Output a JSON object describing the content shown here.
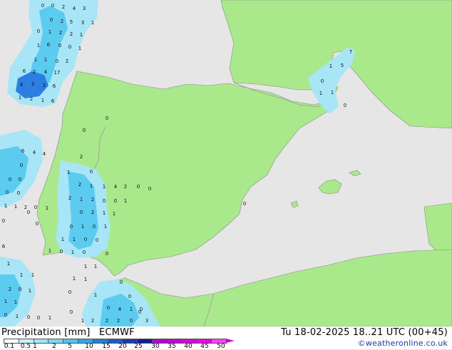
{
  "colors": {
    "sea": "#e6e6e6",
    "land": "#aae88c",
    "border": "#999999",
    "rain_light": "#a8e6f7",
    "rain_mid": "#5ccbf0",
    "rain_heavy": "#2c7fe0",
    "legend": [
      "#ffffff",
      "#c8f0fa",
      "#a0e4f7",
      "#7cd6f2",
      "#50c4ec",
      "#2ca8e4",
      "#1f7ed8",
      "#1e5bc8",
      "#1e38b0",
      "#191c8c",
      "#b400d0",
      "#c800d8",
      "#dc00e4",
      "#f000f0",
      "#ff40ff"
    ]
  },
  "footer": {
    "legend_title": "Precipitation [mm]",
    "model": "ECMWF",
    "valid_time": "Tu 18-02-2025 18..21 UTC (00+45)",
    "credit": "©weatheronline.co.uk",
    "legend_ticks": [
      "0.1",
      "0.5",
      "1",
      "2",
      "5",
      "10",
      "15",
      "20",
      "25",
      "30",
      "35",
      "40",
      "45",
      "50"
    ]
  },
  "map_labels": [
    "0",
    "0",
    "2",
    "4",
    "3",
    "0",
    "2",
    "5",
    "3",
    "1",
    "0",
    "1",
    "2",
    "2",
    "1",
    "1",
    "6",
    "0",
    "0",
    "1",
    "1",
    "1",
    "0",
    "2",
    "6",
    "2",
    "4",
    "17",
    "4",
    "3",
    "2",
    "6",
    "1",
    "2",
    "1",
    "6",
    "6",
    "4",
    "4",
    "0",
    "0",
    "0",
    "0",
    "0",
    "1",
    "1",
    "2",
    "0",
    "1",
    "2",
    "0",
    "1",
    "2",
    "1",
    "1",
    "4",
    "2",
    "0",
    "2",
    "1",
    "2",
    "0",
    "0",
    "1",
    "0",
    "2",
    "1",
    "1",
    "0",
    "1",
    "0",
    "1",
    "1",
    "1",
    "0",
    "0",
    "1",
    "0",
    "1",
    "0",
    "0",
    "1",
    "1",
    "1",
    "1",
    "1",
    "1",
    "1",
    "2",
    "0",
    "1",
    "1",
    "1",
    "0",
    "1",
    "0",
    "0",
    "1",
    "0",
    "1",
    "0",
    "0",
    "4",
    "1",
    "0",
    "0",
    "0",
    "1",
    "2",
    "2",
    "2",
    "0",
    "3",
    "0",
    "0",
    "0",
    "0",
    "1",
    "5",
    "7",
    "0",
    "1",
    "1",
    "0",
    "6",
    "0",
    "0",
    "0",
    "0"
  ]
}
